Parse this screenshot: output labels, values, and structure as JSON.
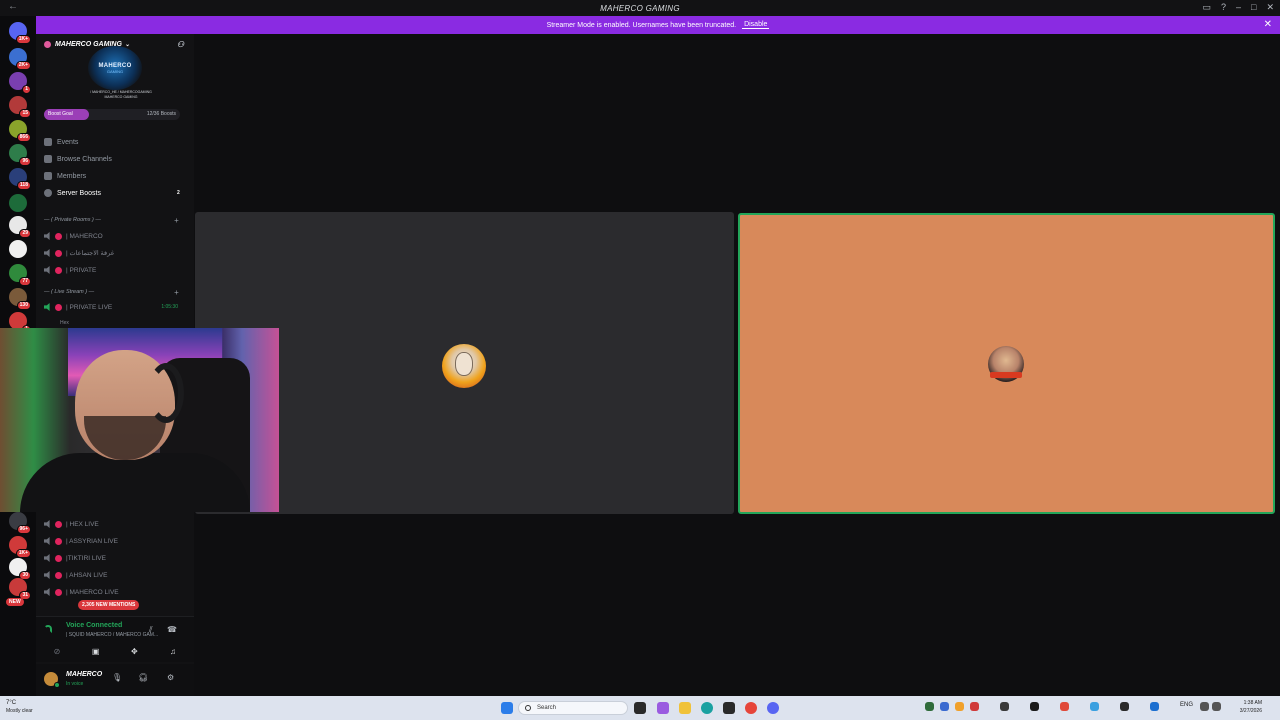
{
  "window": {
    "title": "MAHERCO GAMING"
  },
  "banner": {
    "text": "Streamer Mode is enabled. Usernames have been truncated.",
    "action": "Disable"
  },
  "rail": {
    "badges": [
      "1K+",
      "2K+",
      "1",
      "15",
      "866",
      "96",
      "118",
      "29",
      "77",
      "130",
      "1",
      "96+",
      "1K+",
      "30",
      "31"
    ],
    "new_label": "NEW"
  },
  "server": {
    "name": "MAHERCO GAMING",
    "logo_line1": "MAHERCO",
    "logo_line2": "GAMING",
    "handles_line1": "/ MAHERCO_HE / MAHERCOGAMING",
    "handles_line2": "MAHERCO GAMING",
    "boost_goal": "Boost Goal",
    "boost_count": "12/36 Boosts",
    "boost_progress": 0.333
  },
  "nav": [
    {
      "label": "Events"
    },
    {
      "label": "Browse Channels"
    },
    {
      "label": "Members"
    },
    {
      "label": "Server Boosts",
      "count": "2"
    }
  ],
  "categories": {
    "private": "— ( Private Rooms ) —",
    "live": "— ( Live Stream ) —"
  },
  "channels_private": [
    {
      "name": "| MAHERCO"
    },
    {
      "name": "| غرفة الاجتماعات"
    },
    {
      "name": "| PRIVATE"
    }
  ],
  "channel_live": {
    "name": "| PRIVATE LIVE",
    "time": "1:05:30"
  },
  "member": "Hex",
  "channels_lower": [
    {
      "name": "| HEX LIVE"
    },
    {
      "name": "| ASSYRIAN LIVE"
    },
    {
      "name": "|TIKTIRI LIVE"
    },
    {
      "name": "| AHSAN LIVE"
    },
    {
      "name": "| MAHERCO LIVE"
    }
  ],
  "mentions": "2,305 NEW MENTIONS",
  "voice": {
    "status": "Voice Connected",
    "channel": "| SQUID MAHERCO / MAHERCO GAM..."
  },
  "user": {
    "name": "MAHERCO",
    "status": "In voice"
  },
  "taskbar": {
    "weather_temp": "7°C",
    "weather_desc": "Mostly clear",
    "search_placeholder": "Search",
    "language": "ENG",
    "time": "1:38 AM",
    "date": "3/27/2026"
  },
  "colors": {
    "accent_banner": "#8a2be2",
    "speaking_border": "#23a559",
    "tile_orange": "#d8895a",
    "mention_red": "#da373c"
  }
}
